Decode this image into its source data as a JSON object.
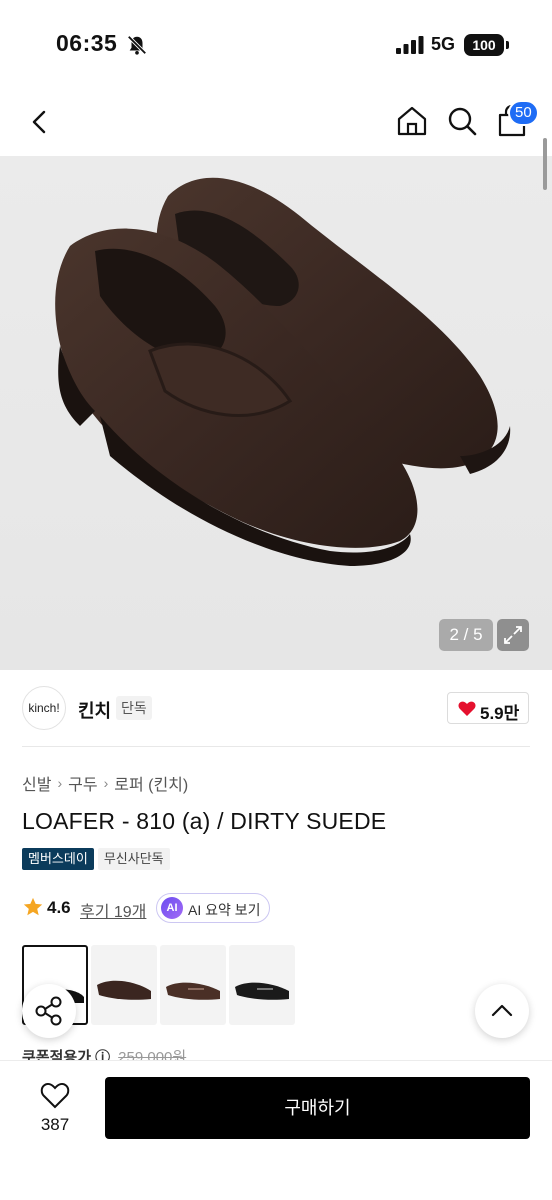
{
  "status_bar": {
    "time": "06:35",
    "network": "5G",
    "battery": "100"
  },
  "header": {
    "cart_count": "50"
  },
  "gallery": {
    "counter": "2 / 5"
  },
  "brand": {
    "logo_text": "kinch!",
    "name": "킨치",
    "tag": "단독",
    "likes": "5.9만"
  },
  "breadcrumb": [
    "신발",
    "구두",
    "로퍼 (킨치)"
  ],
  "product": {
    "title": "LOAFER - 810 (a) / DIRTY SUEDE",
    "tags": [
      "멤버스데이",
      "무신사단독"
    ]
  },
  "rating": {
    "score": "4.6",
    "reviews": "후기 19개",
    "ai_badge": "AI",
    "ai_label": "AI 요약 보기"
  },
  "price_peek": {
    "label": "쿠폰적용가 ⓘ",
    "original": "259,000원"
  },
  "bottom_bar": {
    "like_count": "387",
    "buy_label": "구매하기"
  },
  "colors": {
    "accent_blue": "#1e6cf5",
    "tag_dark": "#0b3b5b",
    "heart_red": "#e5102e"
  }
}
